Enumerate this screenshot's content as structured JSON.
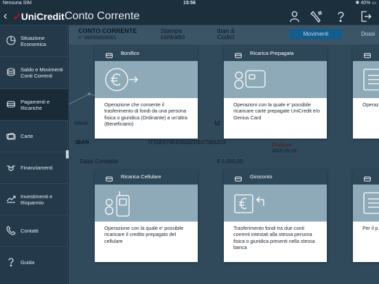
{
  "status": {
    "carrier": "Nessuna SIM",
    "time": "15:56",
    "battery": "40%"
  },
  "header": {
    "back": "‹",
    "brand": "UniCredit",
    "title": "Conto Corrente"
  },
  "top_icons": [
    "user-icon",
    "tools-icon",
    "help-icon",
    "logout-icon"
  ],
  "sidebar": {
    "items": [
      {
        "label": "Situazione Economica",
        "icon": "pie-chart-icon",
        "active": false
      },
      {
        "label": "Saldo e Movimenti Conti Correnti",
        "icon": "coins-icon",
        "active": false
      },
      {
        "label": "Pagamenti e Ricariche",
        "icon": "money-stack-icon",
        "active": true
      },
      {
        "label": "Carte",
        "icon": "card-icon",
        "active": false
      },
      {
        "label": "Finanziamenti",
        "icon": "handshake-icon",
        "active": false
      },
      {
        "label": "Investimenti e Risparmio",
        "icon": "trend-icon",
        "active": false
      },
      {
        "label": "Contatti",
        "icon": "phone-icon",
        "active": false
      },
      {
        "label": "Guida",
        "icon": "question-icon",
        "active": false
      }
    ]
  },
  "background": {
    "title": "CONTO CORRENTE",
    "number": "n° 000000000001",
    "stampa": "Stampa",
    "stampa2": "contratto",
    "iban_link": "Iban &",
    "iban_link2": "Codici",
    "tab_movimenti": "Movimenti",
    "tab_other": "Dossi",
    "intestatario": "Intest",
    "iban_label": "IBAN",
    "iban_value": "IT15E0745105032D8475B6203",
    "saldo_label": "Saldo Contabile",
    "saldo_value": "€ 1.500,00",
    "prelievo": "Prelievo",
    "prelievo_date": "2015-05-10",
    "letter_m": "M"
  },
  "cards": [
    {
      "title": "Bonifico",
      "icon": "euro-arrow-icon",
      "desc": "Operazione che consente il trasferimento di fondi da una persona fisica o giuridica (Ordinante) a un'altra (Beneficiario)"
    },
    {
      "title": "Ricarica Prepagata",
      "icon": "prepaid-card-icon",
      "desc": "Operazioni con la quale e' possibile ricaricare carte prepagate UniCredit e/o Genius Card"
    },
    {
      "title": "",
      "icon": "document-icon",
      "desc": "Operaz... di fisca... non pr..."
    },
    {
      "title": "Ricarica Cellulare",
      "icon": "mobile-phone-icon",
      "desc": "Operazione con la quale e' possibile ricaricare il credito prepagato del cellulare"
    },
    {
      "title": "Giroconto",
      "icon": "euro-transfer-icon",
      "desc": "Trasferimento fondi tra due conti correnti intestati alla stessa persona fisica o giuridica presenti nella stessa banca"
    },
    {
      "title": "",
      "icon": "document-icon",
      "desc": "Per il p... MAV, R..."
    }
  ]
}
